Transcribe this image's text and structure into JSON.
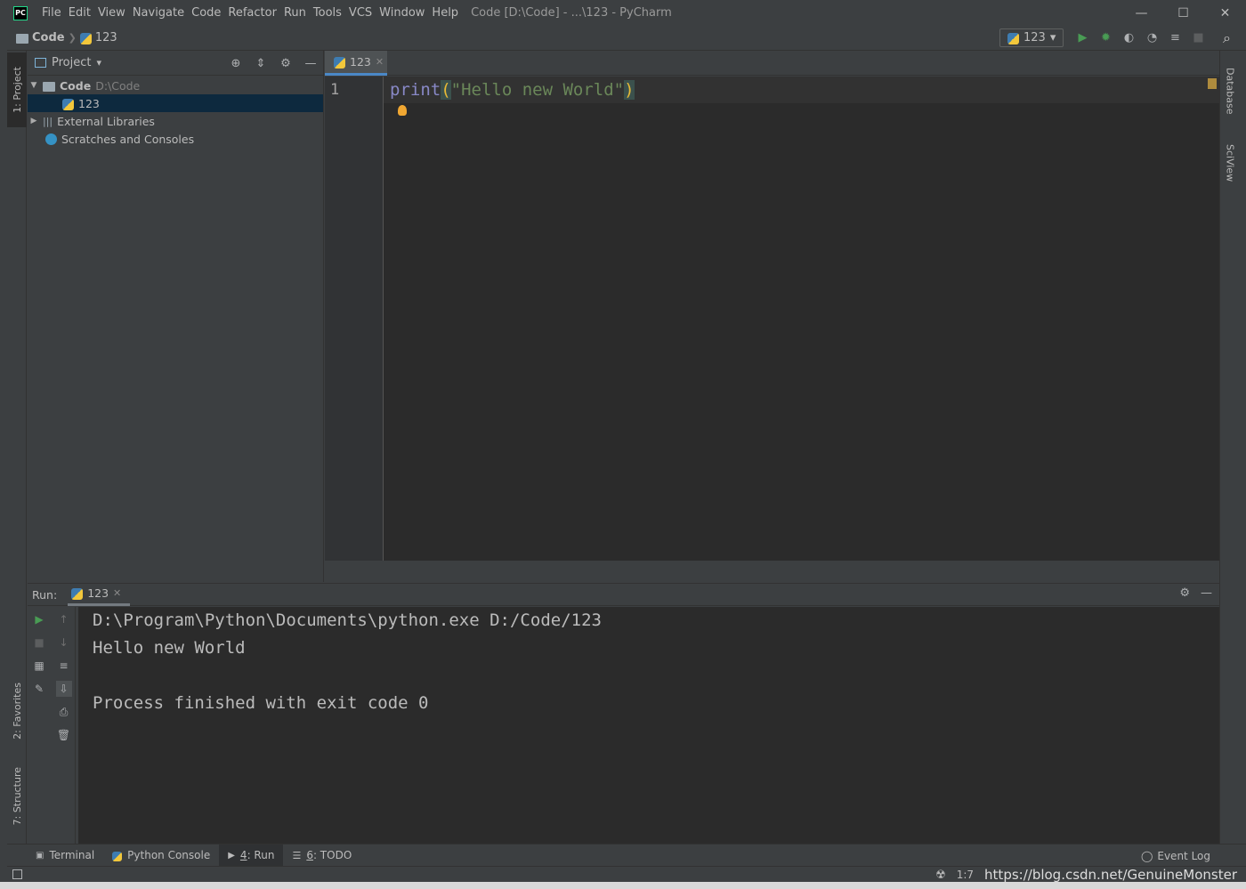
{
  "window": {
    "logo_text": "PC",
    "title": "Code [D:\\Code] - ...\\123 - PyCharm",
    "minimize": "—",
    "maximize": "☐",
    "close": "✕"
  },
  "menu": [
    {
      "label": "File"
    },
    {
      "label": "Edit"
    },
    {
      "label": "View"
    },
    {
      "label": "Navigate"
    },
    {
      "label": "Code"
    },
    {
      "label": "Refactor"
    },
    {
      "label": "Run"
    },
    {
      "label": "Tools"
    },
    {
      "label": "VCS"
    },
    {
      "label": "Window"
    },
    {
      "label": "Help"
    }
  ],
  "breadcrumb": {
    "project": "Code",
    "file": "123"
  },
  "run_config": {
    "name": "123",
    "dropdown": "▾"
  },
  "toolbar": {
    "run_icon": "▶",
    "debug_icon": "✹",
    "coverage_icon": "◐",
    "profile_icon": "◔",
    "concurrency_icon": "≡",
    "stop_icon": "■",
    "search_icon": "⌕"
  },
  "left_tool_tabs": {
    "project": "1: Project",
    "favorites": "2: Favorites",
    "structure": "7: Structure"
  },
  "right_tool_tabs": {
    "database": "Database",
    "sciview": "SciView"
  },
  "project_panel": {
    "title": "Project",
    "dropdown": "▾",
    "tree": {
      "root_name": "Code",
      "root_path": "D:\\Code",
      "file": "123",
      "external_libraries": "External Libraries",
      "scratches": "Scratches and Consoles"
    }
  },
  "editor": {
    "tab_label": "123",
    "line_number": "1",
    "code": {
      "func": "print",
      "open_paren": "(",
      "string": "\"Hello new World\"",
      "close_paren": ")"
    }
  },
  "run_panel": {
    "label": "Run:",
    "tab_label": "123",
    "console_lines": [
      "D:\\Program\\Python\\Documents\\python.exe D:/Code/123",
      "Hello new World",
      "",
      "Process finished with exit code 0"
    ]
  },
  "bottom_tabs": {
    "terminal": "Terminal",
    "python_console": "Python Console",
    "run_prefix": "4",
    "run_rest": ": Run",
    "todo_prefix": "6",
    "todo_rest": ": TODO",
    "event_log": "Event Log"
  },
  "status_bar": {
    "position": "1:7",
    "watermark": "https://blog.csdn.net/GenuineMonster"
  }
}
